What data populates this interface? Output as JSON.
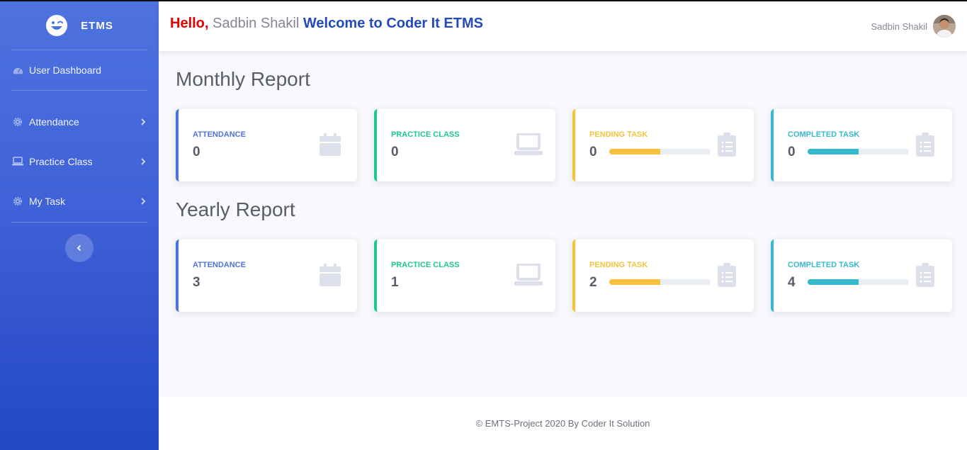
{
  "brand": {
    "name": "ETMS",
    "icon": "laugh-wink-icon"
  },
  "sidebar": {
    "dashboard": {
      "label": "User Dashboard",
      "icon": "tachometer-icon"
    },
    "items": [
      {
        "label": "Attendance",
        "icon": "cog-icon"
      },
      {
        "label": "Practice Class",
        "icon": "laptop-icon"
      },
      {
        "label": "My Task",
        "icon": "cog-icon"
      }
    ],
    "toggle_icon": "chevron-left-icon"
  },
  "topbar": {
    "hello": "Hello,",
    "user_name": "Sadbin Shakil",
    "welcome": "Welcome to Coder It ETMS",
    "account_name": "Sadbin Shakil"
  },
  "monthly": {
    "heading": "Monthly Report",
    "cards": [
      {
        "title": "ATTENDANCE",
        "value": "0",
        "icon": "calendar-icon"
      },
      {
        "title": "PRACTICE CLASS",
        "value": "0",
        "icon": "laptop-icon"
      },
      {
        "title": "PENDING TASK",
        "value": "0",
        "progress": 0.5,
        "icon": "clipboard-list-icon"
      },
      {
        "title": "COMPLETED TASK",
        "value": "0",
        "progress": 0.5,
        "icon": "clipboard-list-icon"
      }
    ]
  },
  "yearly": {
    "heading": "Yearly Report",
    "cards": [
      {
        "title": "ATTENDANCE",
        "value": "3",
        "icon": "calendar-icon"
      },
      {
        "title": "PRACTICE CLASS",
        "value": "1",
        "icon": "laptop-icon"
      },
      {
        "title": "PENDING TASK",
        "value": "2",
        "progress": 0.5,
        "icon": "clipboard-list-icon"
      },
      {
        "title": "COMPLETED TASK",
        "value": "4",
        "progress": 0.5,
        "icon": "clipboard-list-icon"
      }
    ]
  },
  "colors": {
    "primary": "#4e73df",
    "success": "#1cc88a",
    "warning": "#f6c23e",
    "info": "#36b9cc",
    "hello": "#e60000",
    "welcome": "#224abe"
  },
  "footer": {
    "text": "© EMTS-Project 2020 By Coder It Solution"
  }
}
